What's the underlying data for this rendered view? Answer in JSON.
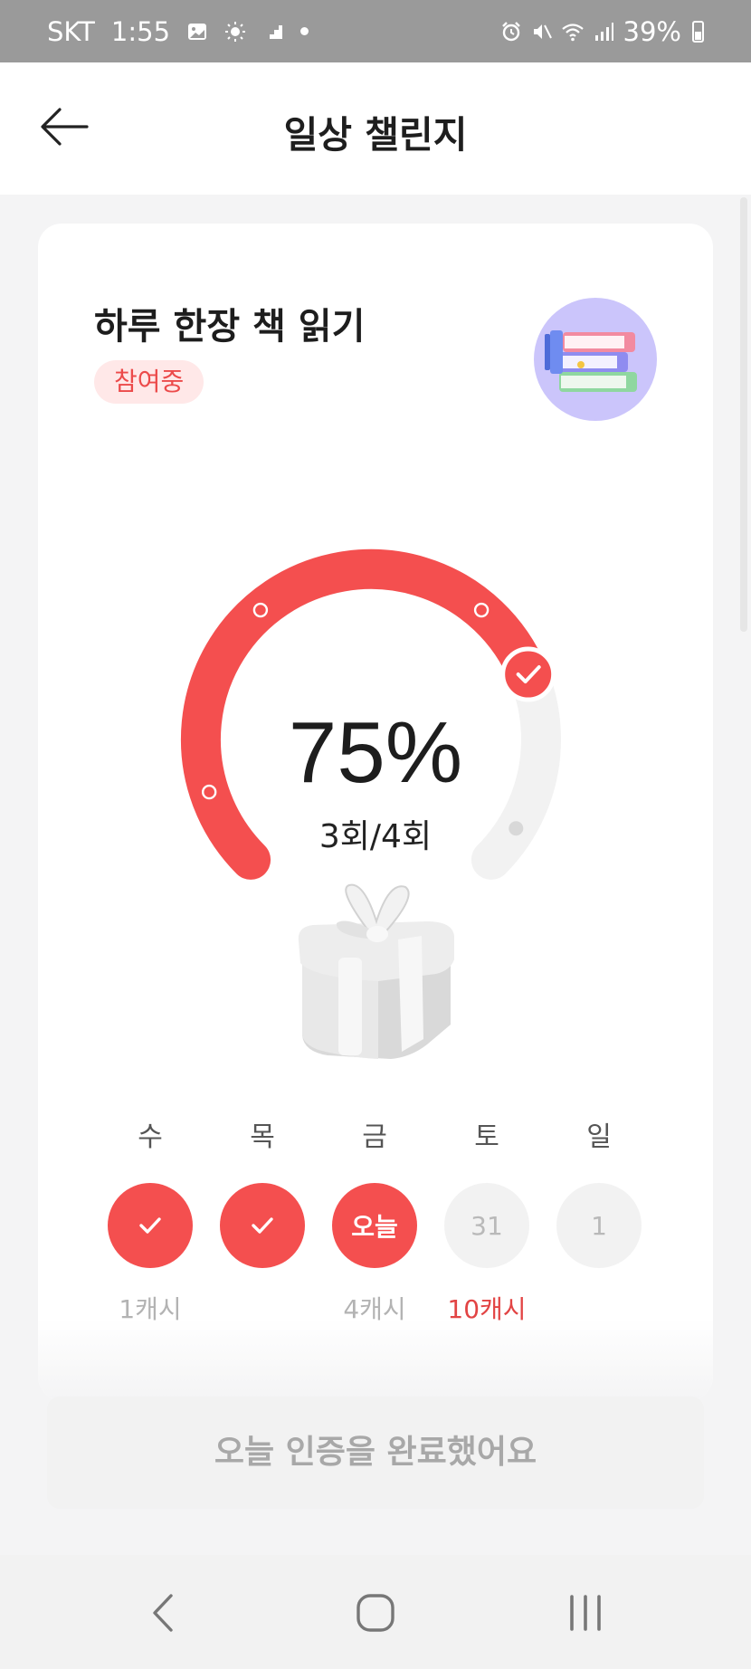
{
  "status_bar": {
    "carrier": "SKT",
    "time": "1:55",
    "battery": "39%"
  },
  "header": {
    "title": "일상 챌린지"
  },
  "challenge": {
    "title": "하루 한장 책 읽기",
    "status": "참여중",
    "percent": "75%",
    "progress_fraction": 0.75,
    "count": "3회/4회"
  },
  "days": [
    {
      "label": "수",
      "state": "done",
      "text": "",
      "reward": "1캐시"
    },
    {
      "label": "목",
      "state": "done",
      "text": "",
      "reward": ""
    },
    {
      "label": "금",
      "state": "today",
      "text": "오늘",
      "reward": "4캐시"
    },
    {
      "label": "토",
      "state": "future",
      "text": "31",
      "reward": "10캐시",
      "reward_highlight": true
    },
    {
      "label": "일",
      "state": "future",
      "text": "1",
      "reward": ""
    }
  ],
  "complete_button": {
    "label": "오늘 인증을 완료했어요"
  },
  "colors": {
    "accent": "#f44f4f",
    "track": "#f2f2f2",
    "badge_bg": "#ffe8e8",
    "avatar_bg": "#cbc5fb"
  },
  "icons": {
    "back": "arrow-left-icon",
    "avatar": "books-icon",
    "gift": "gift-icon",
    "check": "check-icon",
    "nav_back": "chevron-left-icon",
    "nav_home": "home-icon",
    "nav_recents": "recents-icon"
  }
}
